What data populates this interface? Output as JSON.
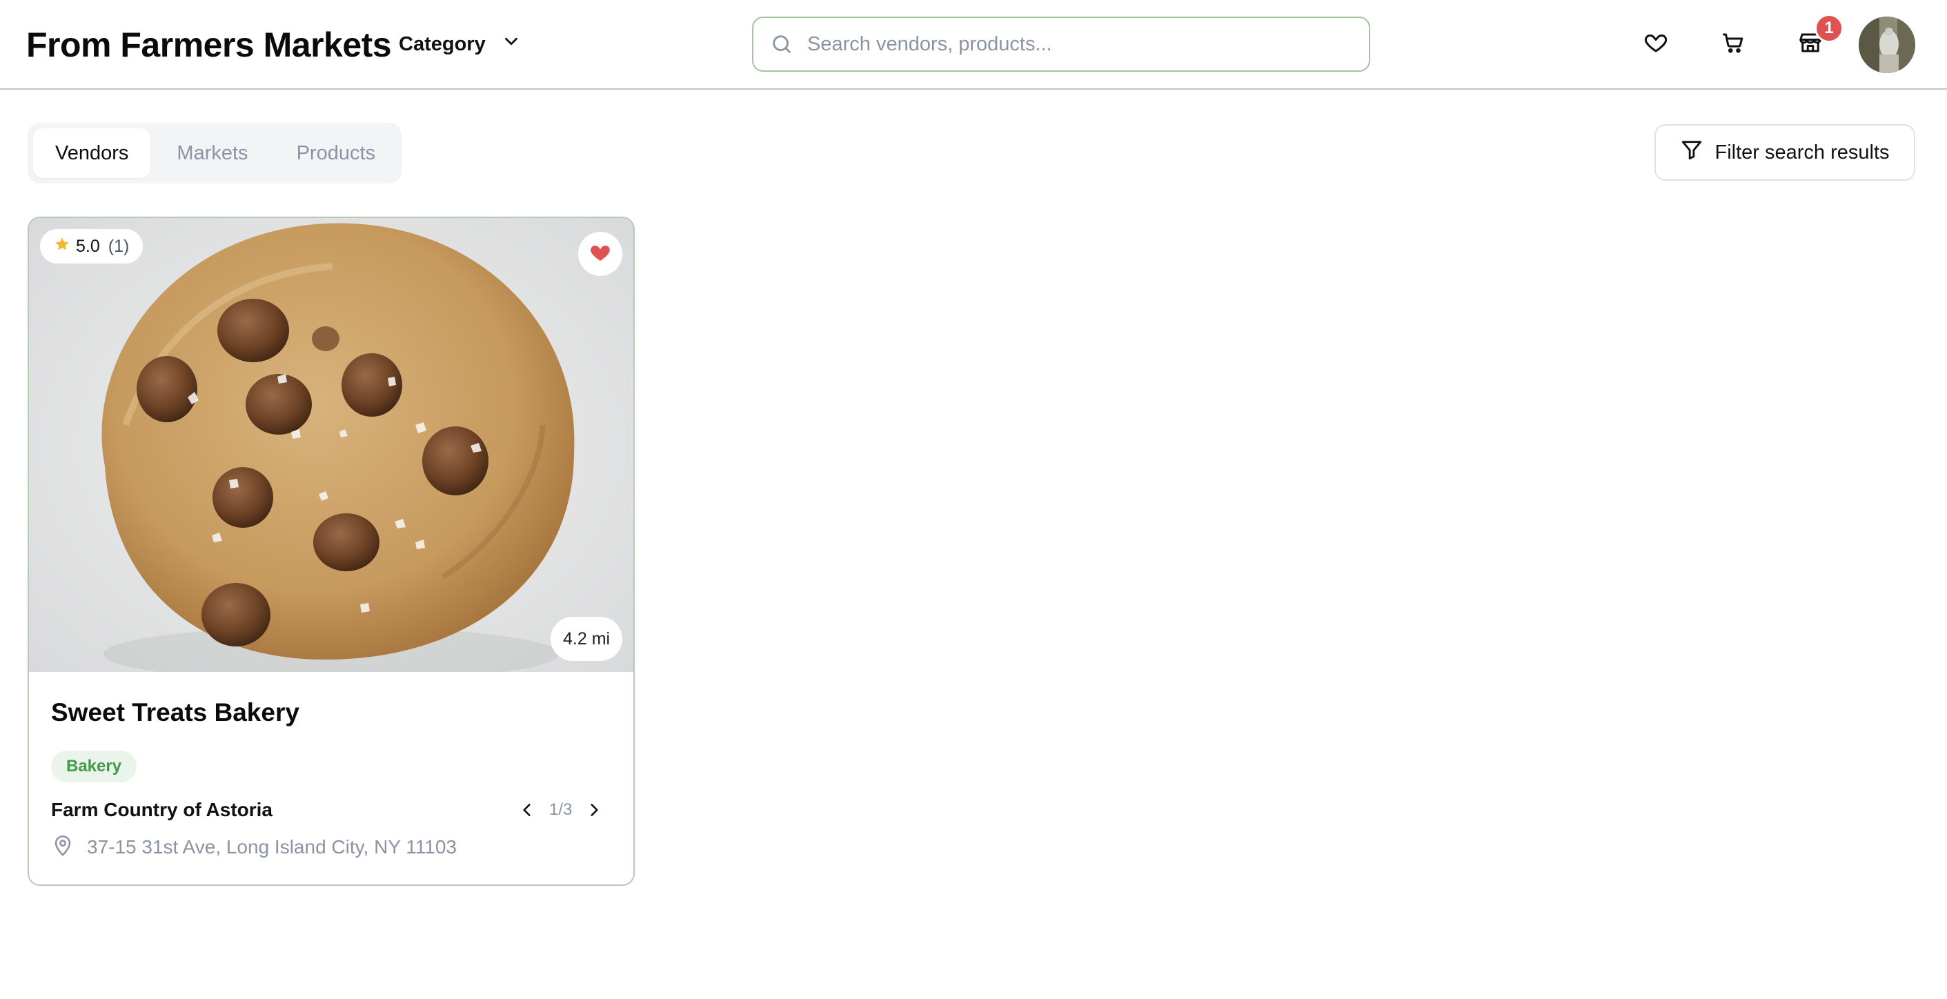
{
  "header": {
    "brand": "From Farmers Markets",
    "category_label": "Category",
    "search_placeholder": "Search vendors, products...",
    "notification_count": "1"
  },
  "tabs": [
    {
      "label": "Vendors",
      "active": true
    },
    {
      "label": "Markets",
      "active": false
    },
    {
      "label": "Products",
      "active": false
    }
  ],
  "filter_button_label": "Filter search results",
  "vendor_card": {
    "rating": "5.0",
    "rating_count": "(1)",
    "favorited": true,
    "distance": "4.2 mi",
    "name": "Sweet Treats Bakery",
    "tag": "Bakery",
    "market": "Farm Country of Astoria",
    "pager": "1/3",
    "address": "37-15 31st Ave, Long Island City, NY 11103"
  },
  "colors": {
    "accent_green": "#3f9b4a",
    "border_green": "#b5ccb1",
    "badge_red": "#e05252",
    "star_gold": "#f2b92f",
    "muted_text": "#8b94a3"
  },
  "icons": [
    "chevron-down-icon",
    "search-icon",
    "heart-icon",
    "cart-icon",
    "store-icon",
    "filter-icon",
    "star-icon",
    "heart-filled-icon",
    "chevron-left-icon",
    "chevron-right-icon",
    "map-pin-icon"
  ]
}
